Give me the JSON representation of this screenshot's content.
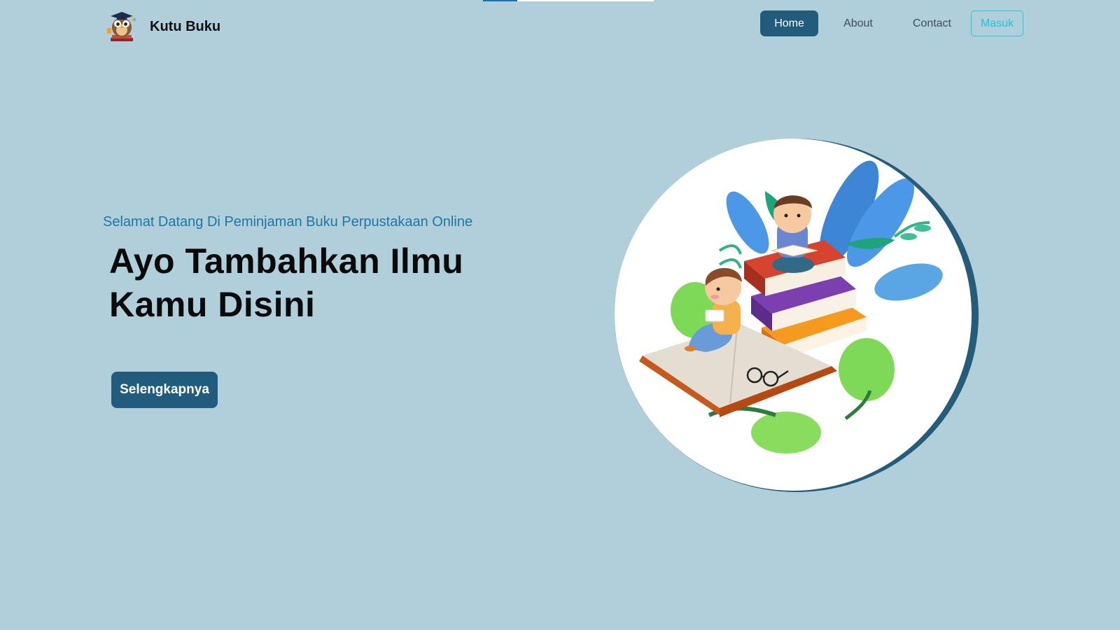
{
  "brand": {
    "name": "Kutu Buku",
    "logo_icon": "owl-graduate-logo"
  },
  "nav": {
    "home": "Home",
    "about": "About",
    "contact": "Contact",
    "login": "Masuk",
    "active_color": "#215c7c",
    "login_color": "#22c0dd"
  },
  "hero": {
    "subtitle": "Selamat Datang Di Peminjaman Buku Perpustakaan Online",
    "title_line1": "Ayo Tambahkan Ilmu",
    "title_line2": "Kamu Disini",
    "cta_label": "Selengkapnya"
  },
  "illustration": {
    "icon": "children-reading-books-illustration"
  },
  "colors": {
    "background": "#b1cfdb",
    "accent": "#215c7c",
    "subtitle": "#1c77a6"
  }
}
